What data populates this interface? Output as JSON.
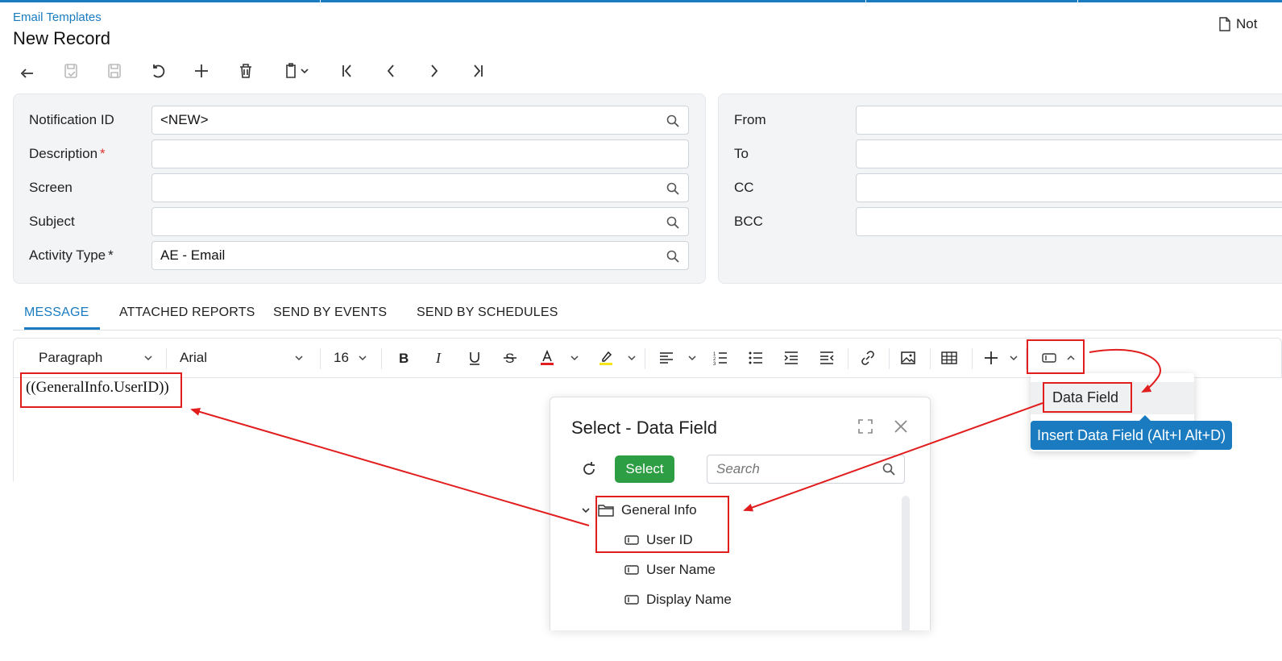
{
  "breadcrumb": "Email Templates",
  "page_title": "New Record",
  "notes_label": "Not",
  "toolbar": {
    "icons": [
      "back-icon",
      "save-close-icon",
      "save-icon",
      "undo-icon",
      "add-icon",
      "delete-icon",
      "clipboard-icon",
      "first-record-icon",
      "previous-record-icon",
      "next-record-icon",
      "last-record-icon"
    ]
  },
  "form_left": {
    "notification_id": {
      "label": "Notification ID",
      "value": "<NEW>"
    },
    "description": {
      "label": "Description",
      "value": ""
    },
    "screen": {
      "label": "Screen",
      "value": ""
    },
    "subject": {
      "label": "Subject",
      "value": ""
    },
    "activity_type": {
      "label": "Activity Type",
      "value": "AE - Email"
    }
  },
  "form_right": {
    "from": {
      "label": "From",
      "value": ""
    },
    "to": {
      "label": "To",
      "value": ""
    },
    "cc": {
      "label": "CC",
      "value": ""
    },
    "bcc": {
      "label": "BCC",
      "value": ""
    }
  },
  "required_marker": "*",
  "tabs": [
    "MESSAGE",
    "ATTACHED REPORTS",
    "SEND BY EVENTS",
    "SEND BY SCHEDULES"
  ],
  "editor": {
    "block_style": "Paragraph",
    "font_family": "Arial",
    "font_size": "16",
    "text_color": "#e11d1d",
    "highlight_color": "#f5e51b",
    "content": "((GeneralInfo.UserID))"
  },
  "dropdown": {
    "item": "Data Field",
    "tooltip": "Insert Data Field (Alt+I Alt+D)"
  },
  "dialog": {
    "title": "Select - Data Field",
    "select_button": "Select",
    "search_placeholder": "Search",
    "tree": {
      "folder": "General Info",
      "fields": [
        "User ID",
        "User Name",
        "Display Name"
      ]
    }
  },
  "colors": {
    "accent": "#1a7bc0",
    "annotation": "#e11d1d",
    "select_button": "#2e9e44"
  }
}
